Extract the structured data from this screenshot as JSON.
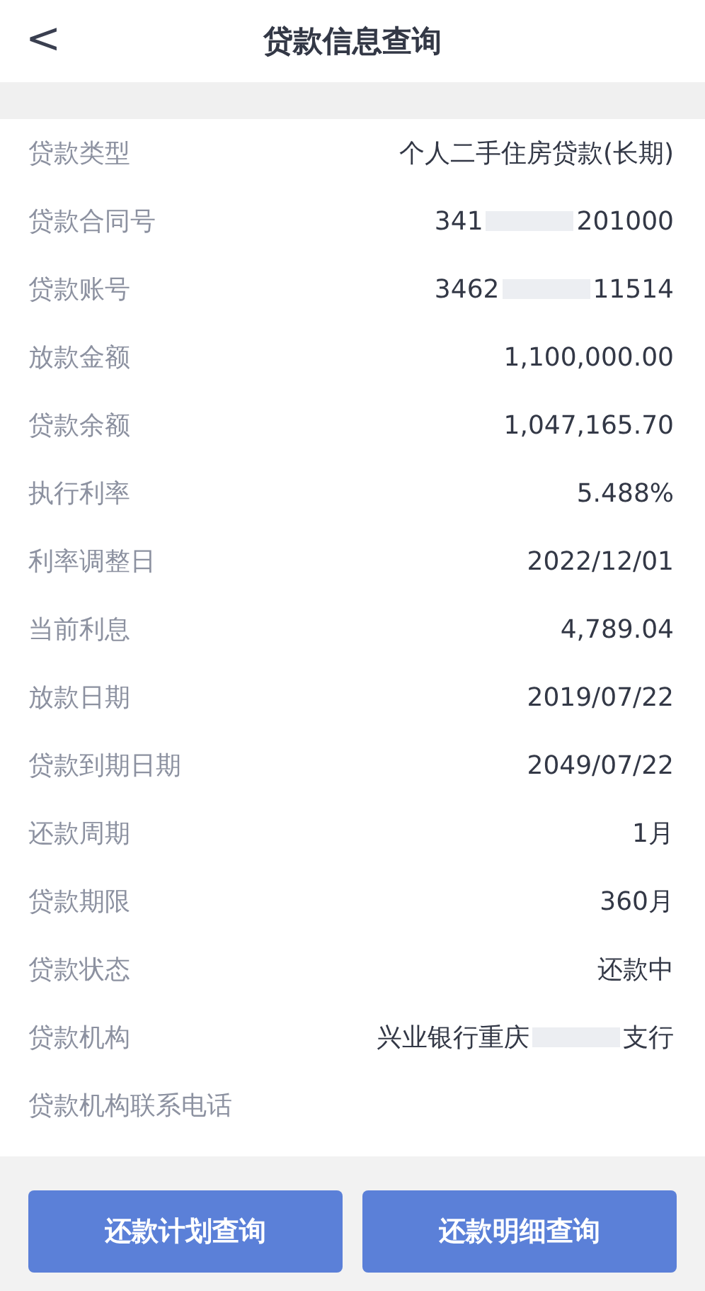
{
  "header": {
    "back": "<",
    "title": "贷款信息查询"
  },
  "rows": [
    {
      "label": "贷款类型",
      "value_parts": [
        "个人二手住房贷款(长期)"
      ]
    },
    {
      "label": "贷款合同号",
      "value_parts": [
        "341",
        "201000"
      ]
    },
    {
      "label": "贷款账号",
      "value_parts": [
        "3462",
        "11514"
      ]
    },
    {
      "label": "放款金额",
      "value_parts": [
        "1,100,000.00"
      ]
    },
    {
      "label": "贷款余额",
      "value_parts": [
        "1,047,165.70"
      ]
    },
    {
      "label": "执行利率",
      "value_parts": [
        "5.488%"
      ]
    },
    {
      "label": "利率调整日",
      "value_parts": [
        "2022/12/01"
      ]
    },
    {
      "label": "当前利息",
      "value_parts": [
        "4,789.04"
      ]
    },
    {
      "label": "放款日期",
      "value_parts": [
        "2019/07/22"
      ]
    },
    {
      "label": "贷款到期日期",
      "value_parts": [
        "2049/07/22"
      ]
    },
    {
      "label": "还款周期",
      "value_parts": [
        "1月"
      ]
    },
    {
      "label": "贷款期限",
      "value_parts": [
        "360月"
      ]
    },
    {
      "label": "贷款状态",
      "value_parts": [
        "还款中"
      ]
    },
    {
      "label": "贷款机构",
      "value_parts": [
        "兴业银行重庆",
        "支行"
      ]
    },
    {
      "label": "贷款机构联系电话",
      "value_parts": []
    }
  ],
  "buttons": [
    "还款计划查询",
    "还款明细查询"
  ]
}
